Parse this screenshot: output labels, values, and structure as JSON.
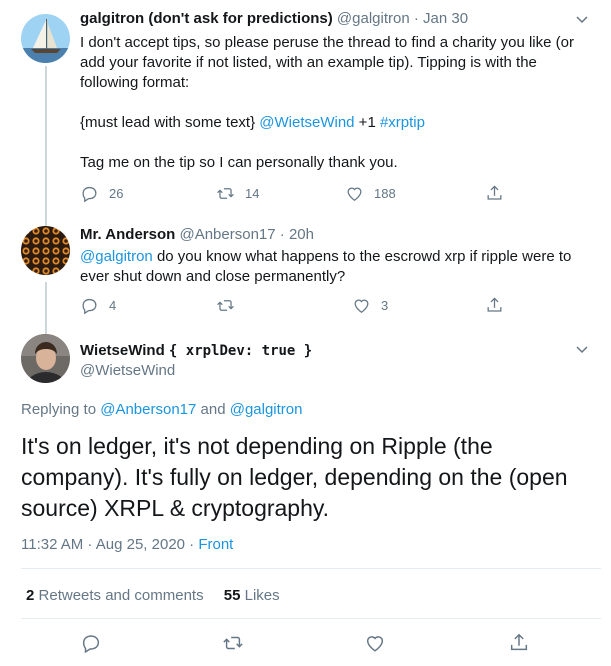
{
  "tweets": [
    {
      "name": "galgitron (don't ask for predictions)",
      "handle": "@galgitron",
      "dot": "·",
      "date": "Jan 30",
      "text_1": "I don't accept tips, so please peruse the thread to find a charity you like (or",
      "text_2": "add your favorite if not listed, with an example tip).  Tipping is with the",
      "text_3": "following format:",
      "text_4_prefix": "{must lead with some text} ",
      "text_4_mention": "@WietseWind",
      "text_4_mid": " +1 ",
      "text_4_tag": "#xrptip",
      "text_5": "Tag me on the tip so I can personally thank you.",
      "replies": "26",
      "retweets": "14",
      "likes": "188"
    },
    {
      "name": "Mr. Anderson",
      "handle": "@Anberson17",
      "dot": "·",
      "date": "20h",
      "mention": "@galgitron",
      "text_1": " do you know what happens to the  escrowd xrp if ripple were to",
      "text_2": "ever shut down and close permanently?",
      "replies": "4",
      "retweets": "",
      "likes": "3"
    }
  ],
  "main_tweet": {
    "name": "WietseWind",
    "code_open": "{ ",
    "code_key": "xrplDev",
    "code_sep": ": ",
    "code_val": "true",
    "code_close": " }",
    "handle": "@WietseWind",
    "replying_prefix": "Replying to ",
    "replying_user1": "@Anberson17",
    "replying_and": " and ",
    "replying_user2": "@galgitron",
    "text_1": "It's on ledger, it's not depending on Ripple (the",
    "text_2": "company). It's fully on ledger, depending on the (open",
    "text_3": "source) XRPL & cryptography.",
    "time": "11:32 AM · Aug 25, 2020 · ",
    "source": "Front",
    "retweet_count": "2",
    "retweet_label": "Retweets and comments",
    "like_count": "55",
    "like_label": "Likes"
  },
  "colors": {
    "accent": "#1b95e0",
    "muted": "#657786",
    "text": "#14171a",
    "border": "#e6ecf0"
  },
  "icons": [
    "reply-icon",
    "retweet-icon",
    "like-icon",
    "share-icon",
    "chevron-down-icon"
  ]
}
